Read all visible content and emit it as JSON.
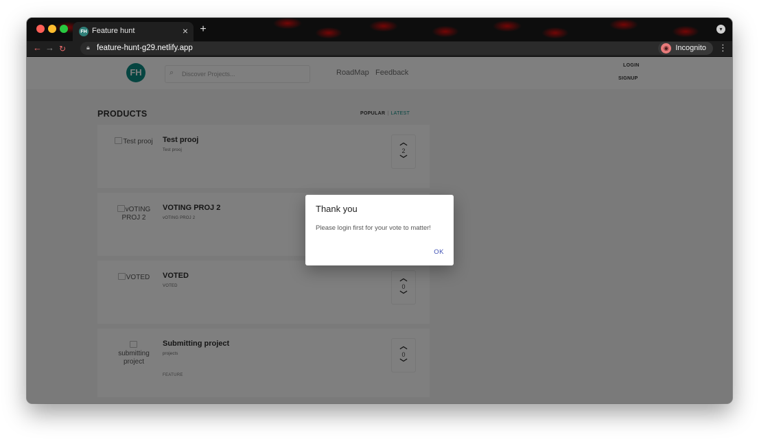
{
  "browser": {
    "tab_title": "Feature hunt",
    "tab_favicon": "FH",
    "tab_close": "×",
    "new_tab": "+",
    "url": "feature-hunt-g29.netlify.app",
    "incognito_label": "Incognito",
    "icons": [
      "back-arrow-icon",
      "forward-arrow-icon",
      "reload-icon",
      "lock-icon",
      "star-icon",
      "incognito-icon",
      "menu-dots-icon"
    ]
  },
  "header": {
    "logo": "FH",
    "search_placeholder": "Discover Projects...",
    "nav": {
      "roadmap": "RoadMap",
      "feedback": "Feedback"
    },
    "login": "LOGIN",
    "signup": "SIGNUP"
  },
  "products": {
    "title": "PRODUCTS",
    "sort_popular": "POPULAR",
    "sort_separator": "|",
    "sort_latest": "LATEST",
    "items": [
      {
        "img_alt": "Test prooj",
        "title": "Test prooj",
        "subtitle": "Test prooj",
        "tag": "",
        "votes": "2"
      },
      {
        "img_alt": "vOTING PROJ 2",
        "title": "VOTING PROJ 2",
        "subtitle": "vOTING PROJ 2",
        "tag": "",
        "votes": ""
      },
      {
        "img_alt": "VOTED",
        "title": "VOTED",
        "subtitle": "VOTED",
        "tag": "",
        "votes": "0"
      },
      {
        "img_alt": "submitting project",
        "title": "Submitting project",
        "subtitle": "projects",
        "tag": "FEATURE",
        "votes": "0"
      }
    ]
  },
  "dialog": {
    "title": "Thank you",
    "message": "Please login first for your vote to matter!",
    "ok": "OK"
  },
  "colors": {
    "brand": "#0c8a82",
    "dialog_button": "#3f51b5"
  }
}
